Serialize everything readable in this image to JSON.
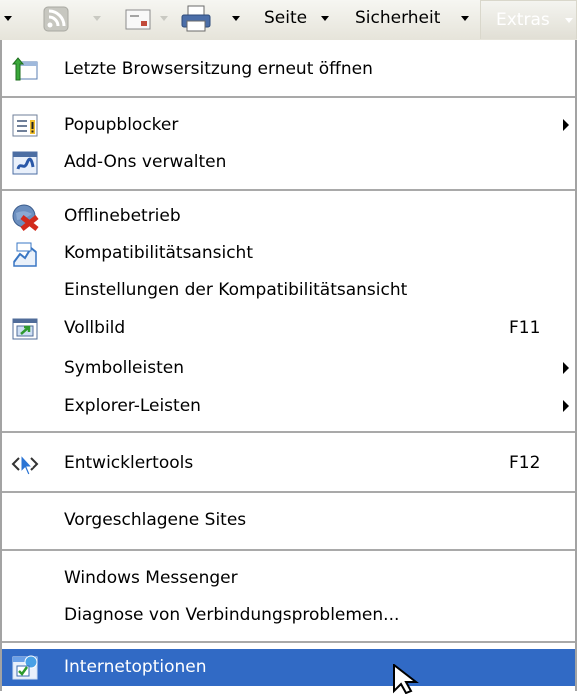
{
  "toolbar": {
    "page_label": "Seite",
    "security_label": "Sicherheit",
    "extras_label": "Extras"
  },
  "menu": {
    "items": [
      {
        "label": "Letzte Browsersitzung erneut öffnen",
        "icon": "reopen-session-icon"
      },
      {
        "label": "Popupblocker",
        "icon": "popup-blocker-icon",
        "submenu": true
      },
      {
        "label": "Add-Ons verwalten",
        "icon": "addons-icon"
      },
      {
        "label": "Offlinebetrieb",
        "icon": "offline-icon"
      },
      {
        "label": "Kompatibilitätsansicht",
        "icon": "compatibility-icon"
      },
      {
        "label": "Einstellungen der Kompatibilitätsansicht"
      },
      {
        "label": "Vollbild",
        "icon": "fullscreen-icon",
        "shortcut": "F11"
      },
      {
        "label": "Symbolleisten",
        "submenu": true
      },
      {
        "label": "Explorer-Leisten",
        "submenu": true
      },
      {
        "label": "Entwicklertools",
        "icon": "developer-tools-icon",
        "shortcut": "F12"
      },
      {
        "label": "Vorgeschlagene Sites"
      },
      {
        "label": "Windows Messenger"
      },
      {
        "label": "Diagnose von Verbindungsproblemen..."
      },
      {
        "label": "Internetoptionen",
        "icon": "internet-options-icon",
        "selected": true
      }
    ]
  },
  "colors": {
    "highlight": "#316ac5",
    "separator": "#a9a9a9"
  }
}
